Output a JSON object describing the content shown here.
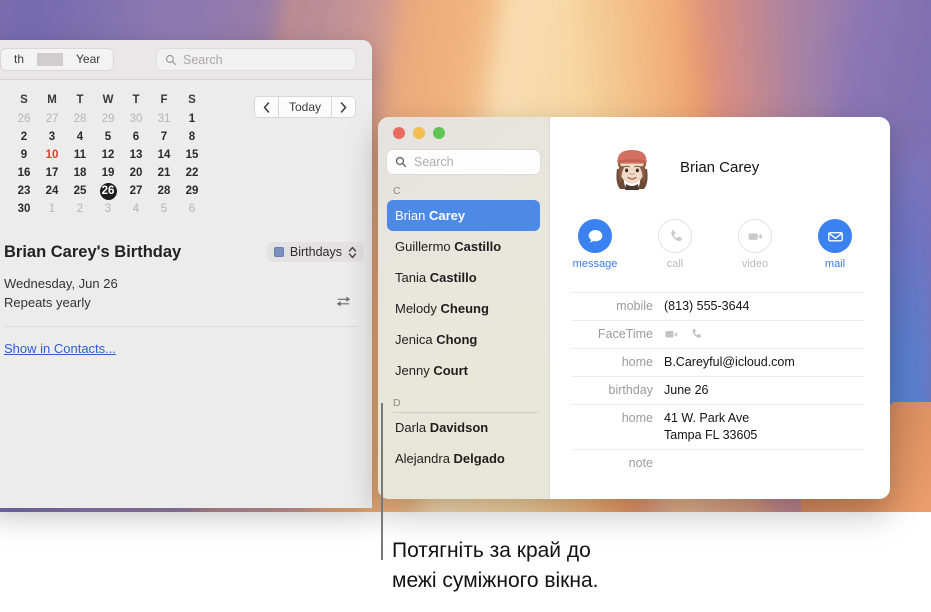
{
  "calendar": {
    "toolbar": {
      "segment_month": "th",
      "segment_year": "Year",
      "search_placeholder": "Search",
      "search_icon": "search-icon"
    },
    "minimonth": {
      "weekday_headers": [
        "S",
        "M",
        "T",
        "W",
        "T",
        "F",
        "S"
      ],
      "weeks": [
        [
          {
            "d": "26",
            "s": "dim"
          },
          {
            "d": "27",
            "s": "dim"
          },
          {
            "d": "28",
            "s": "dim"
          },
          {
            "d": "29",
            "s": "dim"
          },
          {
            "d": "30",
            "s": "dim"
          },
          {
            "d": "31",
            "s": "dim"
          },
          {
            "d": "1",
            "s": "normal"
          }
        ],
        [
          {
            "d": "2",
            "s": "normal"
          },
          {
            "d": "3",
            "s": "normal"
          },
          {
            "d": "4",
            "s": "normal"
          },
          {
            "d": "5",
            "s": "normal"
          },
          {
            "d": "6",
            "s": "normal"
          },
          {
            "d": "7",
            "s": "normal"
          },
          {
            "d": "8",
            "s": "normal"
          }
        ],
        [
          {
            "d": "9",
            "s": "normal"
          },
          {
            "d": "10",
            "s": "today"
          },
          {
            "d": "11",
            "s": "normal"
          },
          {
            "d": "12",
            "s": "normal"
          },
          {
            "d": "13",
            "s": "normal"
          },
          {
            "d": "14",
            "s": "normal"
          },
          {
            "d": "15",
            "s": "normal"
          }
        ],
        [
          {
            "d": "16",
            "s": "normal"
          },
          {
            "d": "17",
            "s": "normal"
          },
          {
            "d": "18",
            "s": "normal"
          },
          {
            "d": "19",
            "s": "normal"
          },
          {
            "d": "20",
            "s": "normal"
          },
          {
            "d": "21",
            "s": "normal"
          },
          {
            "d": "22",
            "s": "normal"
          }
        ],
        [
          {
            "d": "23",
            "s": "normal"
          },
          {
            "d": "24",
            "s": "normal"
          },
          {
            "d": "25",
            "s": "normal"
          },
          {
            "d": "26",
            "s": "selected"
          },
          {
            "d": "27",
            "s": "normal"
          },
          {
            "d": "28",
            "s": "normal"
          },
          {
            "d": "29",
            "s": "normal"
          }
        ],
        [
          {
            "d": "30",
            "s": "normal"
          },
          {
            "d": "1",
            "s": "dim"
          },
          {
            "d": "2",
            "s": "dim"
          },
          {
            "d": "3",
            "s": "dim"
          },
          {
            "d": "4",
            "s": "dim"
          },
          {
            "d": "5",
            "s": "dim"
          },
          {
            "d": "6",
            "s": "dim"
          }
        ]
      ],
      "today_color": "#e03b2f",
      "selected_color": "#1c1c1c"
    },
    "nav": {
      "prev_icon": "chevron-left-icon",
      "today_label": "Today",
      "next_icon": "chevron-right-icon"
    },
    "event": {
      "title": "Brian Carey's Birthday",
      "calendar_name": "Birthdays",
      "calendar_color": "#7b8fc0",
      "date_line": "Wednesday, Jun 26",
      "repeat_line": "Repeats yearly",
      "repeat_icon": "repeat-icon",
      "show_in_contacts_label": "Show in Contacts...",
      "link_color": "#2d5fd0"
    }
  },
  "contacts": {
    "traffic_lights": [
      "close-button",
      "minimize-button",
      "zoom-button"
    ],
    "search_placeholder": "Search",
    "sections": [
      {
        "letter": "C",
        "ruled": false,
        "people": [
          {
            "first": "Brian ",
            "last": "Carey",
            "selected": true
          },
          {
            "first": "Guillermo ",
            "last": "Castillo",
            "selected": false
          },
          {
            "first": "Tania ",
            "last": "Castillo",
            "selected": false
          },
          {
            "first": "Melody ",
            "last": "Cheung",
            "selected": false
          },
          {
            "first": "Jenica ",
            "last": "Chong",
            "selected": false
          },
          {
            "first": "Jenny ",
            "last": "Court",
            "selected": false
          }
        ]
      },
      {
        "letter": "D",
        "ruled": true,
        "people": [
          {
            "first": "Darla ",
            "last": "Davidson",
            "selected": false
          },
          {
            "first": "Alejandra ",
            "last": "Delgado",
            "selected": false
          }
        ]
      }
    ],
    "selected_color": "#4d8ae8",
    "detail": {
      "avatar_name": "memoji-avatar",
      "name": "Brian Carey",
      "actions": [
        {
          "label": "message",
          "icon": "message-bubble-icon",
          "enabled": true
        },
        {
          "label": "call",
          "icon": "phone-icon",
          "enabled": false
        },
        {
          "label": "video",
          "icon": "video-camera-icon",
          "enabled": false
        },
        {
          "label": "mail",
          "icon": "envelope-icon",
          "enabled": true
        }
      ],
      "fields": [
        {
          "label": "mobile",
          "value": "(813) 555-3644",
          "type": "text"
        },
        {
          "label": "FaceTime",
          "value": "",
          "type": "icons",
          "icons": [
            "video-camera-icon",
            "phone-icon"
          ]
        },
        {
          "label": "home",
          "value": "B.Careyful@icloud.com",
          "type": "text"
        },
        {
          "label": "birthday",
          "value": "June 26",
          "type": "text"
        },
        {
          "label": "home",
          "value": "41 W. Park Ave",
          "value2": "Tampa FL 33605",
          "type": "text2"
        },
        {
          "label": "note",
          "value": "",
          "type": "text"
        }
      ]
    }
  },
  "callout": {
    "caption_line1": "Потягніть за край до",
    "caption_line2": "межі суміжного вікна."
  }
}
